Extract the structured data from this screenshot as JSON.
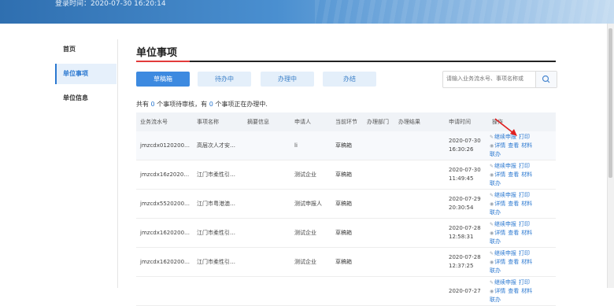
{
  "header": {
    "login_time": "登录时间：2020-07-30 16:20:14"
  },
  "sidebar": {
    "items": [
      {
        "label": "首页"
      },
      {
        "label": "单位事项"
      },
      {
        "label": "单位信息"
      }
    ],
    "active_index": 1
  },
  "main": {
    "title": "单位事项",
    "tabs": [
      {
        "label": "草稿箱"
      },
      {
        "label": "待办中"
      },
      {
        "label": "办理中"
      },
      {
        "label": "办结"
      }
    ],
    "search_placeholder": "请输入业务流水号、事项名称或",
    "summary": {
      "prefix": "共有 ",
      "pending": "0",
      "middle": " 个事项待审核，有 ",
      "processing": "0",
      "suffix": " 个事项正在办理中."
    },
    "columns": [
      "业务流水号",
      "事项名称",
      "摘要信息",
      "申请人",
      "当前环节",
      "办理部门",
      "办理结果",
      "申请时间",
      "操作"
    ],
    "rows": [
      {
        "serial": "jmzcdx0120200…",
        "name": "高层次人才安…",
        "summary": "",
        "applicant": "li",
        "stage": "草稿箱",
        "dept": "",
        "result": "",
        "date": "2020-07-30",
        "time": "16:30:26"
      },
      {
        "serial": "jmzcdx16z2020…",
        "name": "江门市柔性引…",
        "summary": "",
        "applicant": "测试企业",
        "stage": "草稿箱",
        "dept": "",
        "result": "",
        "date": "2020-07-30",
        "time": "11:49:45"
      },
      {
        "serial": "jmzcdx5520200…",
        "name": "江门市粤港澳…",
        "summary": "",
        "applicant": "测试申报人",
        "stage": "草稿箱",
        "dept": "",
        "result": "",
        "date": "2020-07-29",
        "time": "20:30:54"
      },
      {
        "serial": "jmzcdx1620200…",
        "name": "江门市柔性引…",
        "summary": "",
        "applicant": "测试企业",
        "stage": "草稿箱",
        "dept": "",
        "result": "",
        "date": "2020-07-28",
        "time": "12:58:31"
      },
      {
        "serial": "jmzcdx1620200…",
        "name": "江门市柔性引…",
        "summary": "",
        "applicant": "测试企业",
        "stage": "草稿箱",
        "dept": "",
        "result": "",
        "date": "2020-07-28",
        "time": "12:37:25"
      },
      {
        "serial": "",
        "name": "",
        "summary": "",
        "applicant": "",
        "stage": "",
        "dept": "",
        "result": "",
        "date": "2020-07-27",
        "time": ""
      }
    ],
    "actions": {
      "continue": "继续申报",
      "print": "打印",
      "detail": "详情",
      "view": "查看",
      "material": "材料",
      "link": "联办"
    }
  },
  "colors": {
    "accent": "#3d8ae0",
    "title_underline": "#e23b3b",
    "banner": "#4a8fd0"
  }
}
